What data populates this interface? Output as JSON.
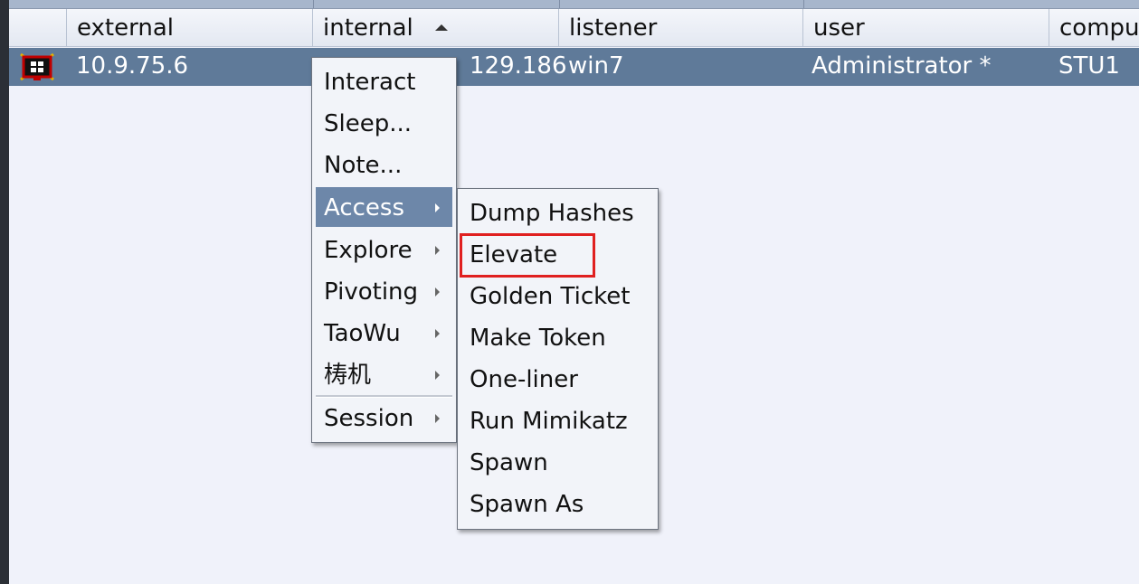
{
  "table": {
    "columns": [
      {
        "label": ""
      },
      {
        "label": "external"
      },
      {
        "label": "internal"
      },
      {
        "label": "listener"
      },
      {
        "label": "user"
      },
      {
        "label": "compu"
      }
    ],
    "sort_indicator": "sort-ascending-icon",
    "rows": [
      {
        "icon": "windows-beacon-icon",
        "external": "10.9.75.6",
        "internal": "192.168.129.186",
        "internal_visible": "129.186",
        "listener": "win7",
        "user": "Administrator *",
        "computer": "STU1"
      }
    ]
  },
  "context_menu": {
    "items": [
      {
        "label": "Interact",
        "has_submenu": false
      },
      {
        "label": "Sleep...",
        "has_submenu": false
      },
      {
        "label": "Note...",
        "has_submenu": false
      },
      {
        "label": "Access",
        "has_submenu": true,
        "selected": true
      },
      {
        "label": "Explore",
        "has_submenu": true
      },
      {
        "label": "Pivoting",
        "has_submenu": true
      },
      {
        "label": "TaoWu",
        "has_submenu": true
      },
      {
        "label": "梼机",
        "has_submenu": true
      },
      {
        "label": "Session",
        "has_submenu": true
      }
    ]
  },
  "access_submenu": {
    "items": [
      {
        "label": "Dump Hashes"
      },
      {
        "label": "Elevate",
        "highlighted": true
      },
      {
        "label": "Golden Ticket"
      },
      {
        "label": "Make Token"
      },
      {
        "label": "One-liner"
      },
      {
        "label": "Run Mimikatz"
      },
      {
        "label": "Spawn"
      },
      {
        "label": "Spawn As"
      }
    ]
  },
  "colors": {
    "row_selected": "#5f7a99",
    "menu_selected": "#6d87a9",
    "annotation_box": "#e02020"
  }
}
